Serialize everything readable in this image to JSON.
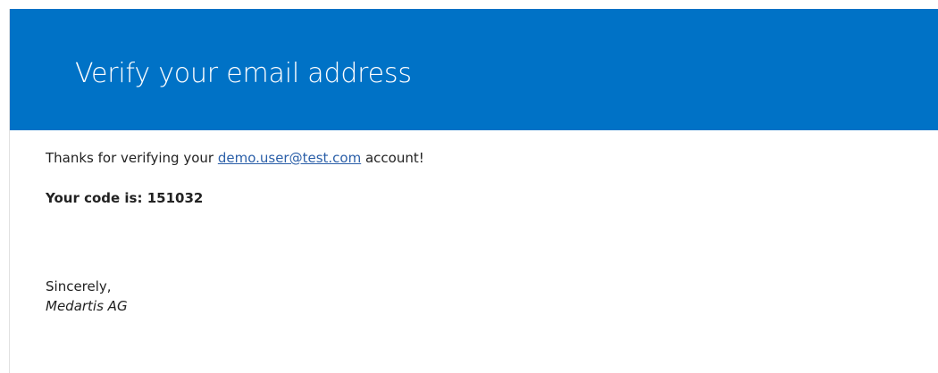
{
  "header": {
    "title": "Verify your email address"
  },
  "message": {
    "thanks_prefix": "Thanks for verifying your ",
    "email": "demo.user@test.com",
    "thanks_suffix": " account!",
    "code_label": "Your code is: ",
    "code_value": "151032",
    "closing": "Sincerely,",
    "company": "Medartis AG"
  },
  "colors": {
    "header_bg": "#0072c6",
    "header_text": "#ffffff",
    "link": "#2b5fa8",
    "body_text": "#222222"
  }
}
